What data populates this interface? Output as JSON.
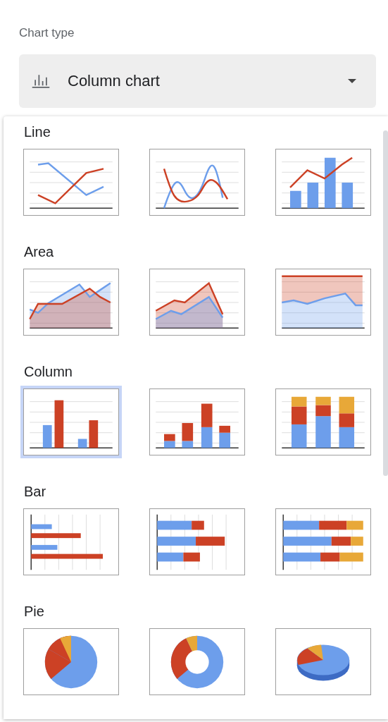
{
  "label": "Chart type",
  "dropdown": {
    "value": "Column chart"
  },
  "sections": [
    {
      "title": "Line",
      "options": [
        {
          "kind": "line",
          "selected": false
        },
        {
          "kind": "smooth_line",
          "selected": false
        },
        {
          "kind": "combo",
          "selected": false
        }
      ]
    },
    {
      "title": "Area",
      "options": [
        {
          "kind": "area",
          "selected": false
        },
        {
          "kind": "stacked_area",
          "selected": false
        },
        {
          "kind": "full_area",
          "selected": false
        }
      ]
    },
    {
      "title": "Column",
      "options": [
        {
          "kind": "column",
          "selected": true
        },
        {
          "kind": "stacked_column",
          "selected": false
        },
        {
          "kind": "full_column",
          "selected": false
        }
      ]
    },
    {
      "title": "Bar",
      "options": [
        {
          "kind": "bar",
          "selected": false
        },
        {
          "kind": "stacked_bar",
          "selected": false
        },
        {
          "kind": "full_bar",
          "selected": false
        }
      ]
    },
    {
      "title": "Pie",
      "options": [
        {
          "kind": "pie",
          "selected": false
        },
        {
          "kind": "donut",
          "selected": false
        },
        {
          "kind": "pie_3d",
          "selected": false
        }
      ]
    }
  ]
}
